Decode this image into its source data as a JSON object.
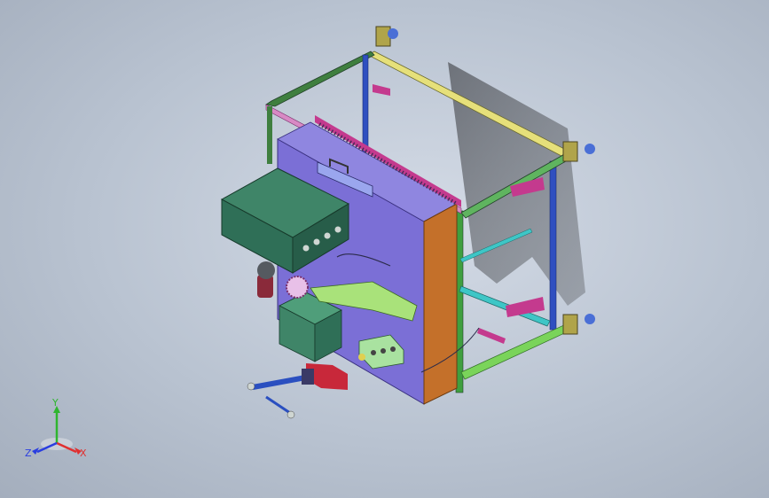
{
  "viewport": {
    "background_top": "#d4dbe6",
    "background_bottom": "#a4aebd"
  },
  "triad": {
    "x_label": "X",
    "y_label": "Y",
    "z_label": "Z",
    "x_color": "#e03030",
    "y_color": "#2fb52f",
    "z_color": "#2a3ee0"
  },
  "model": {
    "frame_top_color": "#e6e07a",
    "frame_green_color": "#3f7f3f",
    "frame_blue_color": "#2f4fc0",
    "frame_cyan_color": "#3ec6c6",
    "panel_color": "#7b6fd6",
    "side_panel_color": "#c4702a",
    "control_box_color": "#2f6f57",
    "rack_color": "#c43a8e"
  }
}
